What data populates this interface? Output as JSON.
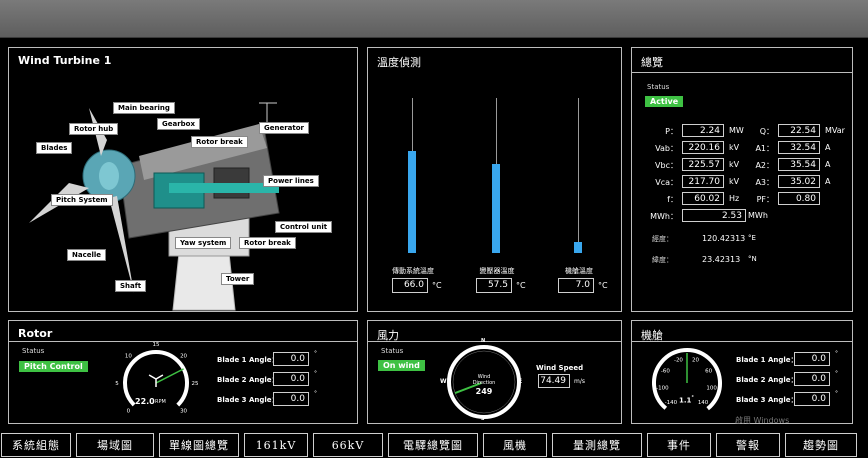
{
  "turbine": {
    "title": "Wind Turbine 1",
    "callouts": {
      "main_bearing": "Main bearing",
      "rotor_hub": "Rotor hub",
      "gearbox": "Gearbox",
      "generator": "Generator",
      "blades": "Blades",
      "rotor_break_top": "Rotor break",
      "power_lines": "Power lines",
      "pitch_system": "Pitch System",
      "control_unit": "Control unit",
      "yaw_system": "Yaw system",
      "rotor_break_bottom": "Rotor break",
      "nacelle": "Nacelle",
      "tower": "Tower",
      "shaft": "Shaft"
    }
  },
  "temperature": {
    "title": "溫度偵測",
    "bars": [
      {
        "label": "傳動系統溫度",
        "value": "66.0",
        "unit": "°C",
        "level": 0.66
      },
      {
        "label": "變壓器溫度",
        "value": "57.5",
        "unit": "°C",
        "level": 0.575
      },
      {
        "label": "機艙溫度",
        "value": "7.0",
        "unit": "°C",
        "level": 0.07
      }
    ]
  },
  "overview": {
    "title": "總覽",
    "status_label": "Status",
    "status_value": "Active",
    "left": [
      {
        "label": "P：",
        "value": "2.24",
        "unit": "MW"
      },
      {
        "label": "Vab：",
        "value": "220.16",
        "unit": "kV"
      },
      {
        "label": "Vbc：",
        "value": "225.57",
        "unit": "kV"
      },
      {
        "label": "Vca：",
        "value": "217.70",
        "unit": "kV"
      },
      {
        "label": "f：",
        "value": "60.02",
        "unit": "Hz"
      }
    ],
    "right": [
      {
        "label": "Q：",
        "value": "22.54",
        "unit": "MVar"
      },
      {
        "label": "A1：",
        "value": "32.54",
        "unit": "A"
      },
      {
        "label": "A2：",
        "value": "35.54",
        "unit": "A"
      },
      {
        "label": "A3：",
        "value": "35.02",
        "unit": "A"
      },
      {
        "label": "PF：",
        "value": "0.80",
        "unit": ""
      }
    ],
    "mwh": {
      "label": "MWh：",
      "value": "2.53",
      "unit": "MWh"
    },
    "longitude": {
      "label": "經度：",
      "value": "120.42313",
      "unit": "°E"
    },
    "latitude": {
      "label": "緯度：",
      "value": "23.42313",
      "unit": "°N"
    }
  },
  "rotor": {
    "title": "Rotor",
    "status_label": "Status",
    "status_value": "Pitch Control",
    "rpm_value": "22.0",
    "rpm_unit": "RPM",
    "gauge_level": 0.733,
    "ticks": [
      "0",
      "5",
      "10",
      "15",
      "20",
      "25",
      "30"
    ],
    "blades": [
      {
        "label": "Blade 1 Angle：",
        "value": "0.0",
        "unit": "°"
      },
      {
        "label": "Blade 2 Angle：",
        "value": "0.0",
        "unit": "°"
      },
      {
        "label": "Blade 3 Angle：",
        "value": "0.0",
        "unit": "°"
      }
    ]
  },
  "wind": {
    "title": "風力",
    "status_label": "Status",
    "status_value": "On wind",
    "compass": {
      "n": "N",
      "e": "E",
      "s": "S",
      "w": "W"
    },
    "direction_label_1": "Wind",
    "direction_label_2": "Direction",
    "direction_value": "249",
    "direction_deg": 249,
    "speed_label": "Wind Speed",
    "speed_value": "74.49",
    "speed_unit": "m/s"
  },
  "nacelle": {
    "title": "機艙",
    "ticks": [
      "-20",
      "20",
      "-60",
      "60",
      "-100",
      "100",
      "-140",
      "140"
    ],
    "value": "1.1",
    "value_unit": "°",
    "blades": [
      {
        "label": "Blade 1 Angle：",
        "value": "0.0",
        "unit": "°"
      },
      {
        "label": "Blade 2 Angle：",
        "value": "0.0",
        "unit": "°"
      },
      {
        "label": "Blade 3 Angle：",
        "value": "0.0",
        "unit": "°"
      }
    ]
  },
  "nav": [
    "系統組態",
    "場域圖",
    "單線圖總覽",
    "161kV",
    "66kV",
    "電驛總覽圖",
    "風機",
    "量測總覽",
    "事件",
    "警報",
    "趨勢圖"
  ],
  "watermark": "啟用 Windows",
  "colors": {
    "accent": "#3ec143",
    "bar": "#39a7ee"
  }
}
